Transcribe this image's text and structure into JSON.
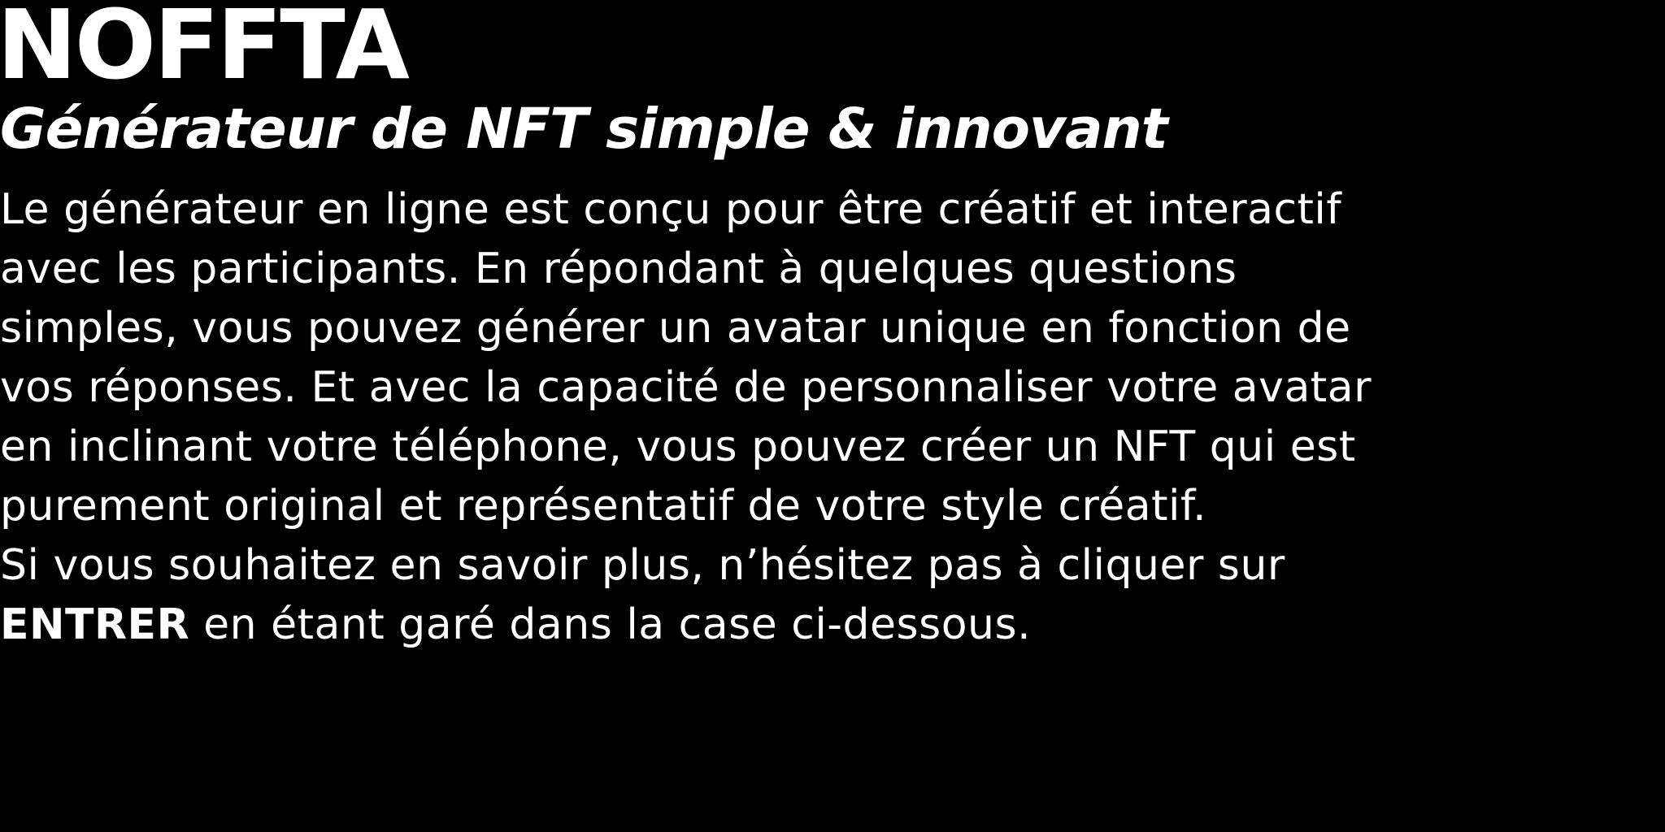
{
  "header": {
    "title": "NOFFTA",
    "subtitle": "Générateur de NFT simple & innovant"
  },
  "description": {
    "lines": [
      "Le générateur en ligne est conçu pour être créatif et interactif",
      "avec les participants. En répondant à quelques questions",
      "simples, vous pouvez générer un avatar unique en fonction de",
      "vos réponses. Et avec la capacité de personnaliser votre avatar",
      "en inclinant votre téléphone, vous pouvez créer un NFT qui est",
      "purement original et représentatif de votre style créatif.",
      "Si vous souhaitez en savoir plus, n’hésitez pas à cliquer sur"
    ],
    "last_line_strong": "ENTRER",
    "last_line_rest": " en étant garé  dans la case ci-dessous."
  },
  "colors": {
    "background": "#000000",
    "text": "#ffffff"
  }
}
